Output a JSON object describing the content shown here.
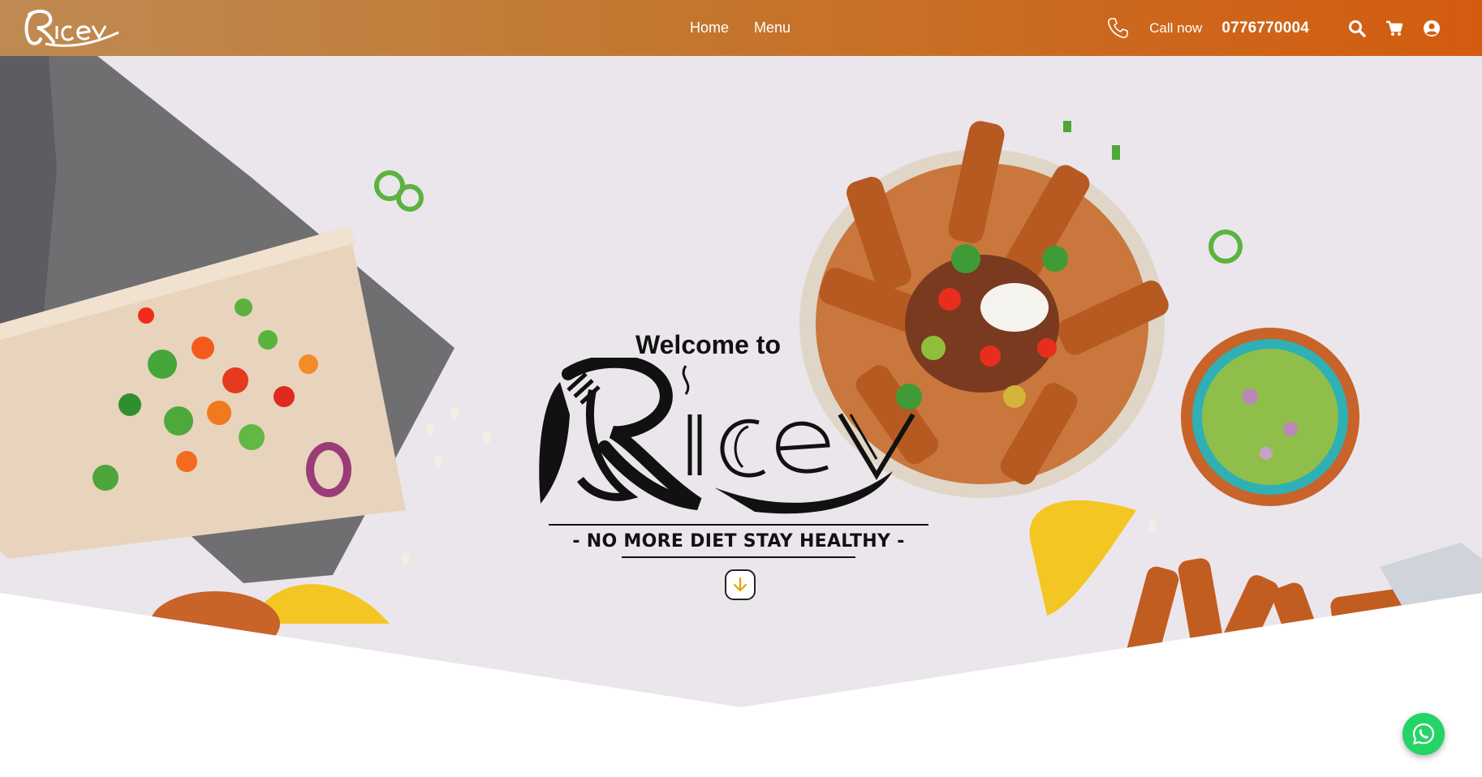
{
  "header": {
    "brand_name": "Ricey",
    "nav": [
      {
        "label": "Home"
      },
      {
        "label": "Menu"
      }
    ],
    "call_label": "Call now",
    "phone_number": "0776770004",
    "icons": [
      "phone-icon",
      "search-icon",
      "cart-icon",
      "user-account-icon"
    ]
  },
  "hero": {
    "welcome": "Welcome to",
    "logo_text": "Ricey",
    "tagline": "- NO MORE DIET STAY HEALTHY -",
    "scroll_icon": "arrow-down-icon"
  },
  "floating": {
    "whatsapp_icon": "whatsapp-icon"
  },
  "colors": {
    "header_start": "#bf8a52",
    "header_end": "#d35c0f",
    "whatsapp": "#25d366",
    "scroll_arrow": "#e0a800"
  }
}
